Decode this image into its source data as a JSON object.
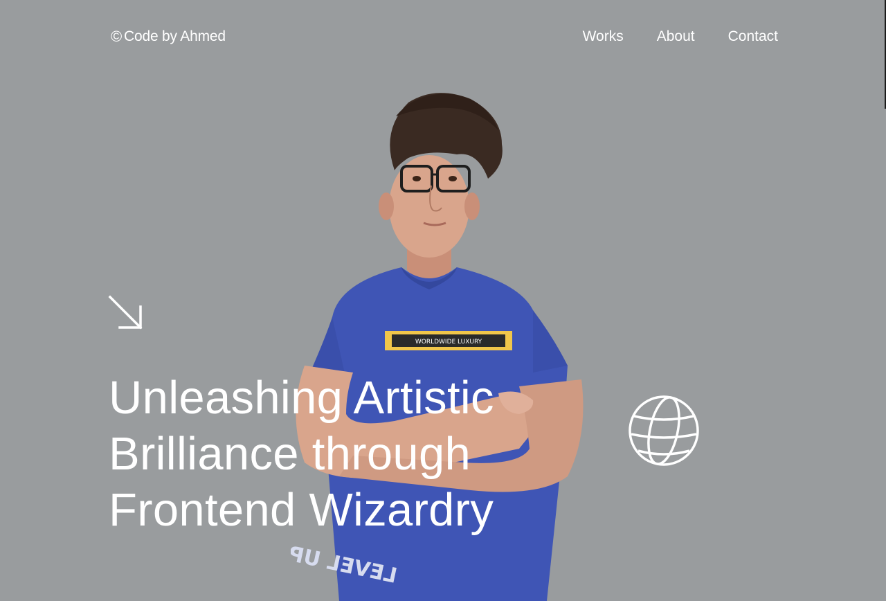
{
  "nav": {
    "logo_symbol": "©",
    "logo_text": "Code by Ahmed",
    "links": [
      {
        "label": "Works"
      },
      {
        "label": "About"
      },
      {
        "label": "Contact"
      }
    ]
  },
  "hero": {
    "headline_lines": [
      "Unleashing Artistic",
      "Brilliance through",
      "Frontend Wizardry"
    ],
    "arrow_icon": "arrow-down-right-icon",
    "globe_icon": "globe-icon",
    "portrait": {
      "shirt_print": "WORLDWIDE LUXURY",
      "shirt_bottom_print": "LEVEL UP"
    }
  },
  "colors": {
    "background": "#999c9e",
    "text": "#ffffff",
    "shirt": "#3f55b5",
    "hair": "#3a2a22",
    "skin": "#d9a58c"
  }
}
